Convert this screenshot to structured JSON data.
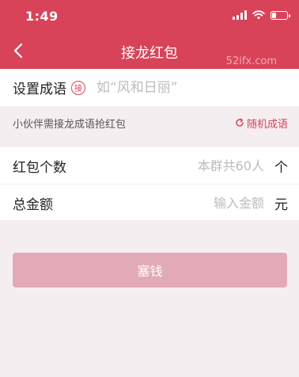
{
  "status_bar": {
    "time": "1:49"
  },
  "header": {
    "title": "接龙红包",
    "watermark": "52ifx.com"
  },
  "idiom": {
    "label": "设置成语",
    "badge": "接",
    "placeholder": "如“风和日丽”"
  },
  "tip": {
    "text": "小伙伴需接龙成语抢红包",
    "random_label": "随机成语"
  },
  "fields": {
    "count": {
      "label": "红包个数",
      "placeholder": "本群共60人",
      "unit": "个"
    },
    "amount": {
      "label": "总金额",
      "placeholder": "输入金额",
      "unit": "元"
    }
  },
  "submit": {
    "label": "塞钱"
  },
  "colors": {
    "accent": "#d8435a",
    "button_disabled": "#e2aab7",
    "background": "#f5eef0"
  }
}
